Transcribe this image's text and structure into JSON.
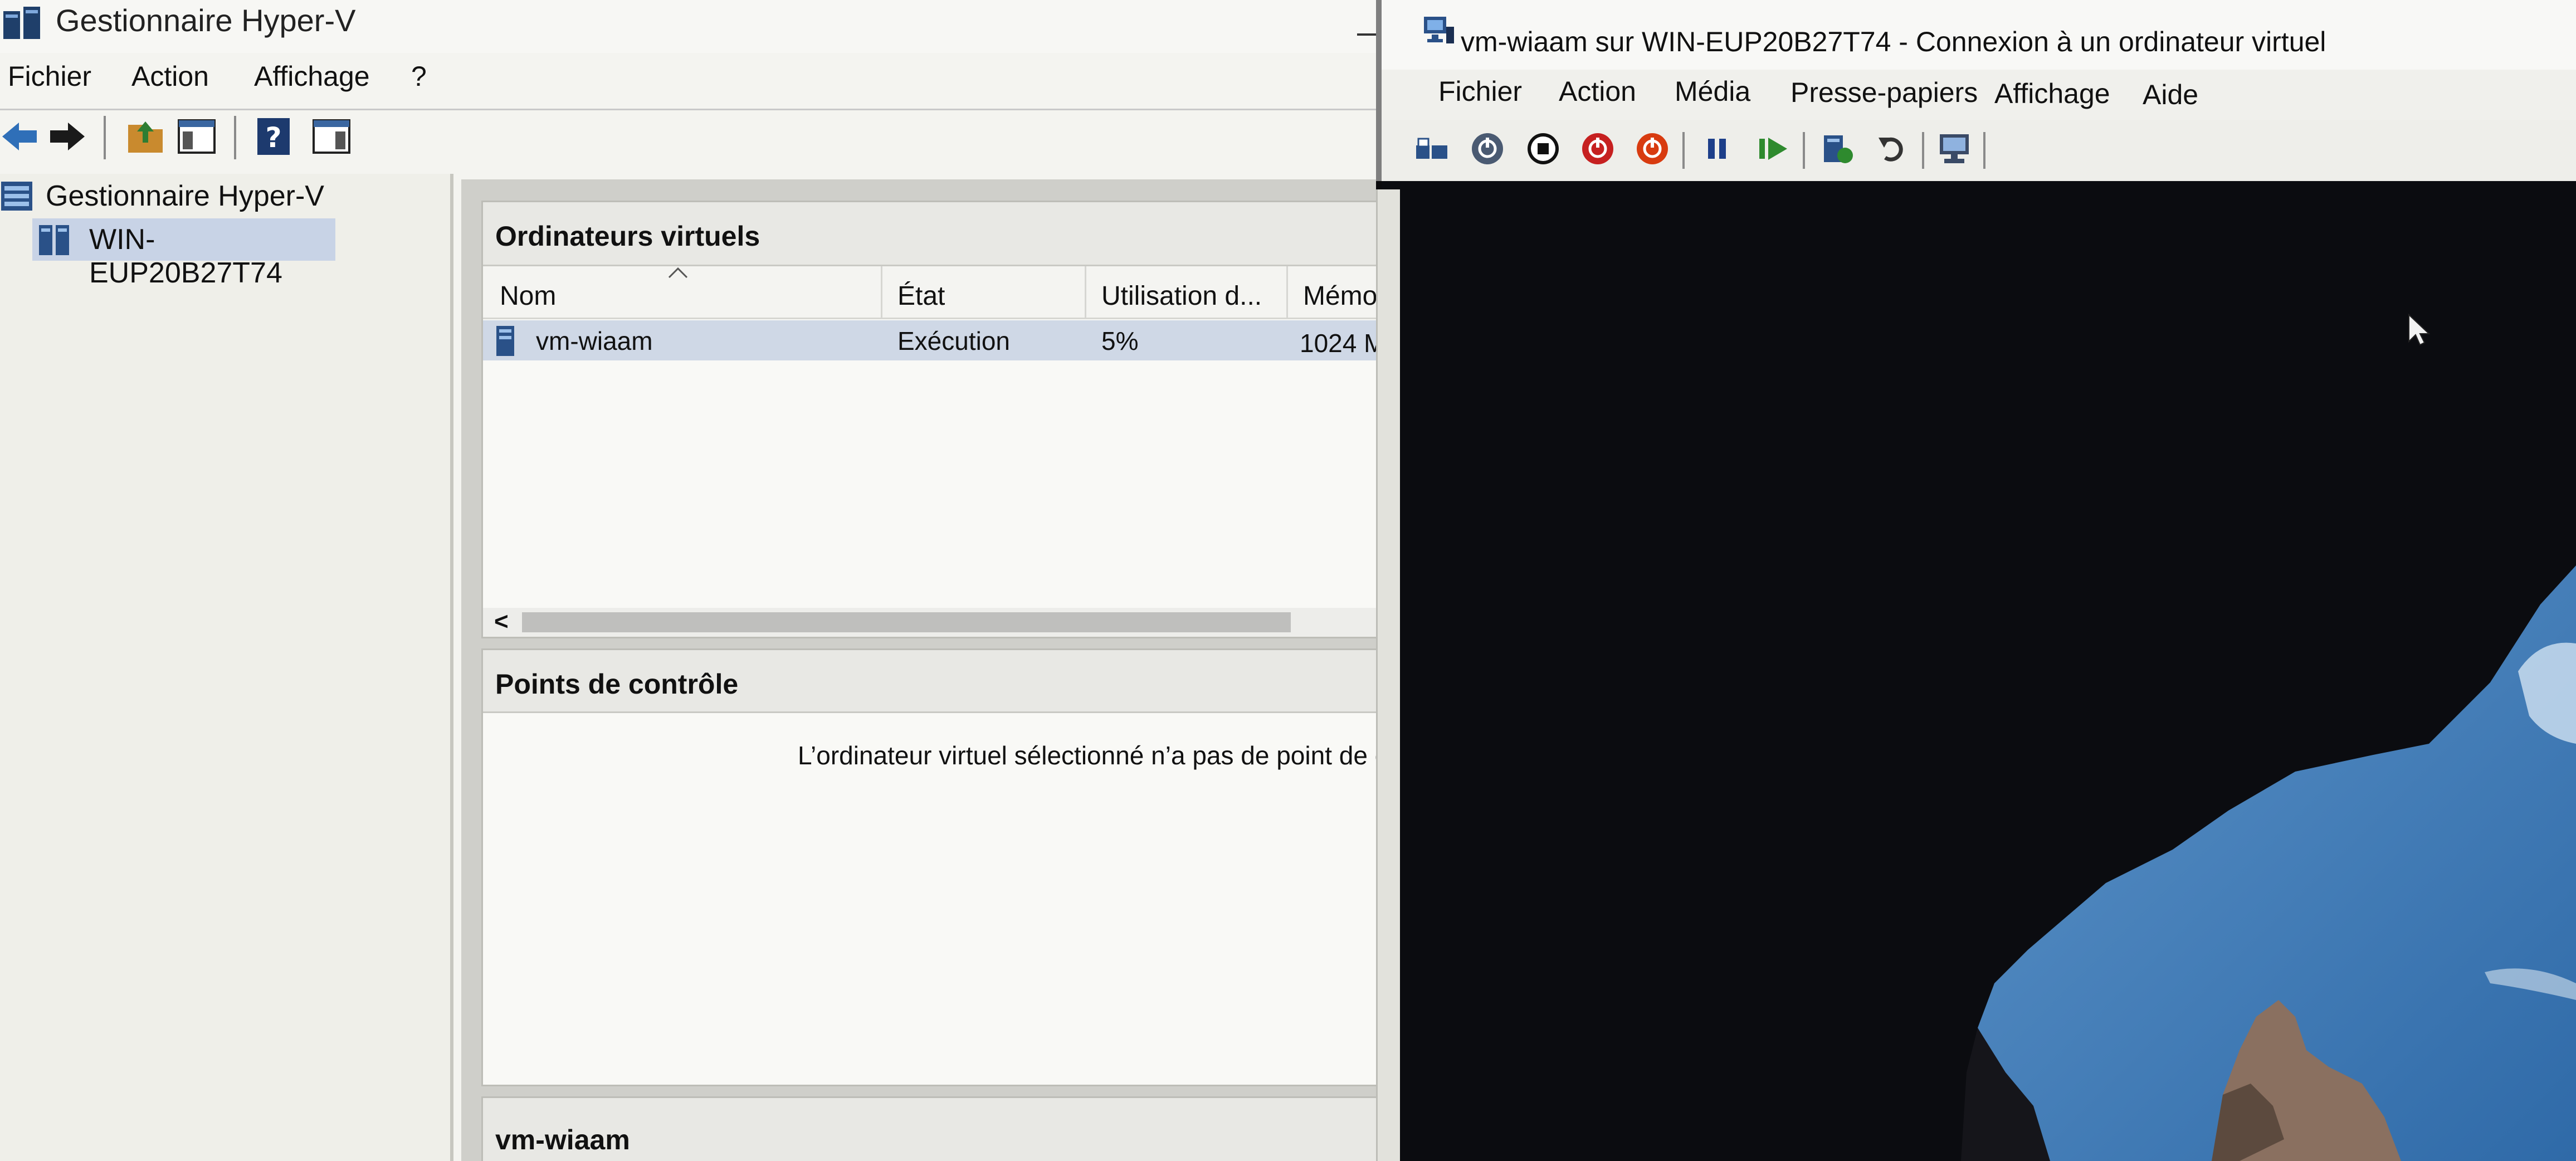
{
  "manager": {
    "title": "Gestionnaire Hyper-V",
    "menu": [
      "Fichier",
      "Action",
      "Affichage",
      "?"
    ],
    "toolbar_icons": [
      "back-icon",
      "forward-icon",
      "up-folder-icon",
      "show-hide-console-tree-icon",
      "help-icon",
      "show-hide-action-pane-icon"
    ],
    "tree": {
      "root": "Gestionnaire Hyper-V",
      "server": "WIN-EUP20B27T74"
    },
    "vm_panel": {
      "title": "Ordinateurs virtuels",
      "columns": [
        "Nom",
        "État",
        "Utilisation d...",
        "Mémoi"
      ],
      "rows": [
        {
          "name": "vm-wiaam",
          "state": "Exécution",
          "cpu": "5%",
          "memory": "1024 M"
        }
      ],
      "scroll_left": "<"
    },
    "checkpoints_panel": {
      "title": "Points de contrôle",
      "message": "L’ordinateur virtuel sélectionné n’a pas de point de c"
    },
    "details_panel": {
      "title": "vm-wiaam"
    }
  },
  "vm_window": {
    "title": "vm-wiaam sur WIN-EUP20B27T74 - Connexion à un ordinateur virtuel",
    "menu": [
      "Fichier",
      "Action",
      "Média",
      "Presse-papiers",
      "Affichage",
      "Aide"
    ],
    "toolbar_icons": [
      "ctrl-alt-del-icon",
      "start-icon",
      "turn-off-icon",
      "shutdown-icon",
      "save-icon",
      "pause-icon",
      "reset-icon",
      "checkpoint-icon",
      "revert-icon",
      "enhanced-session-icon"
    ]
  },
  "colors": {
    "selection": "#cfd8e6",
    "server_highlight": "#c8d3e6",
    "vm_screen": "#0b0c10",
    "sky": "#3f7fc4"
  }
}
